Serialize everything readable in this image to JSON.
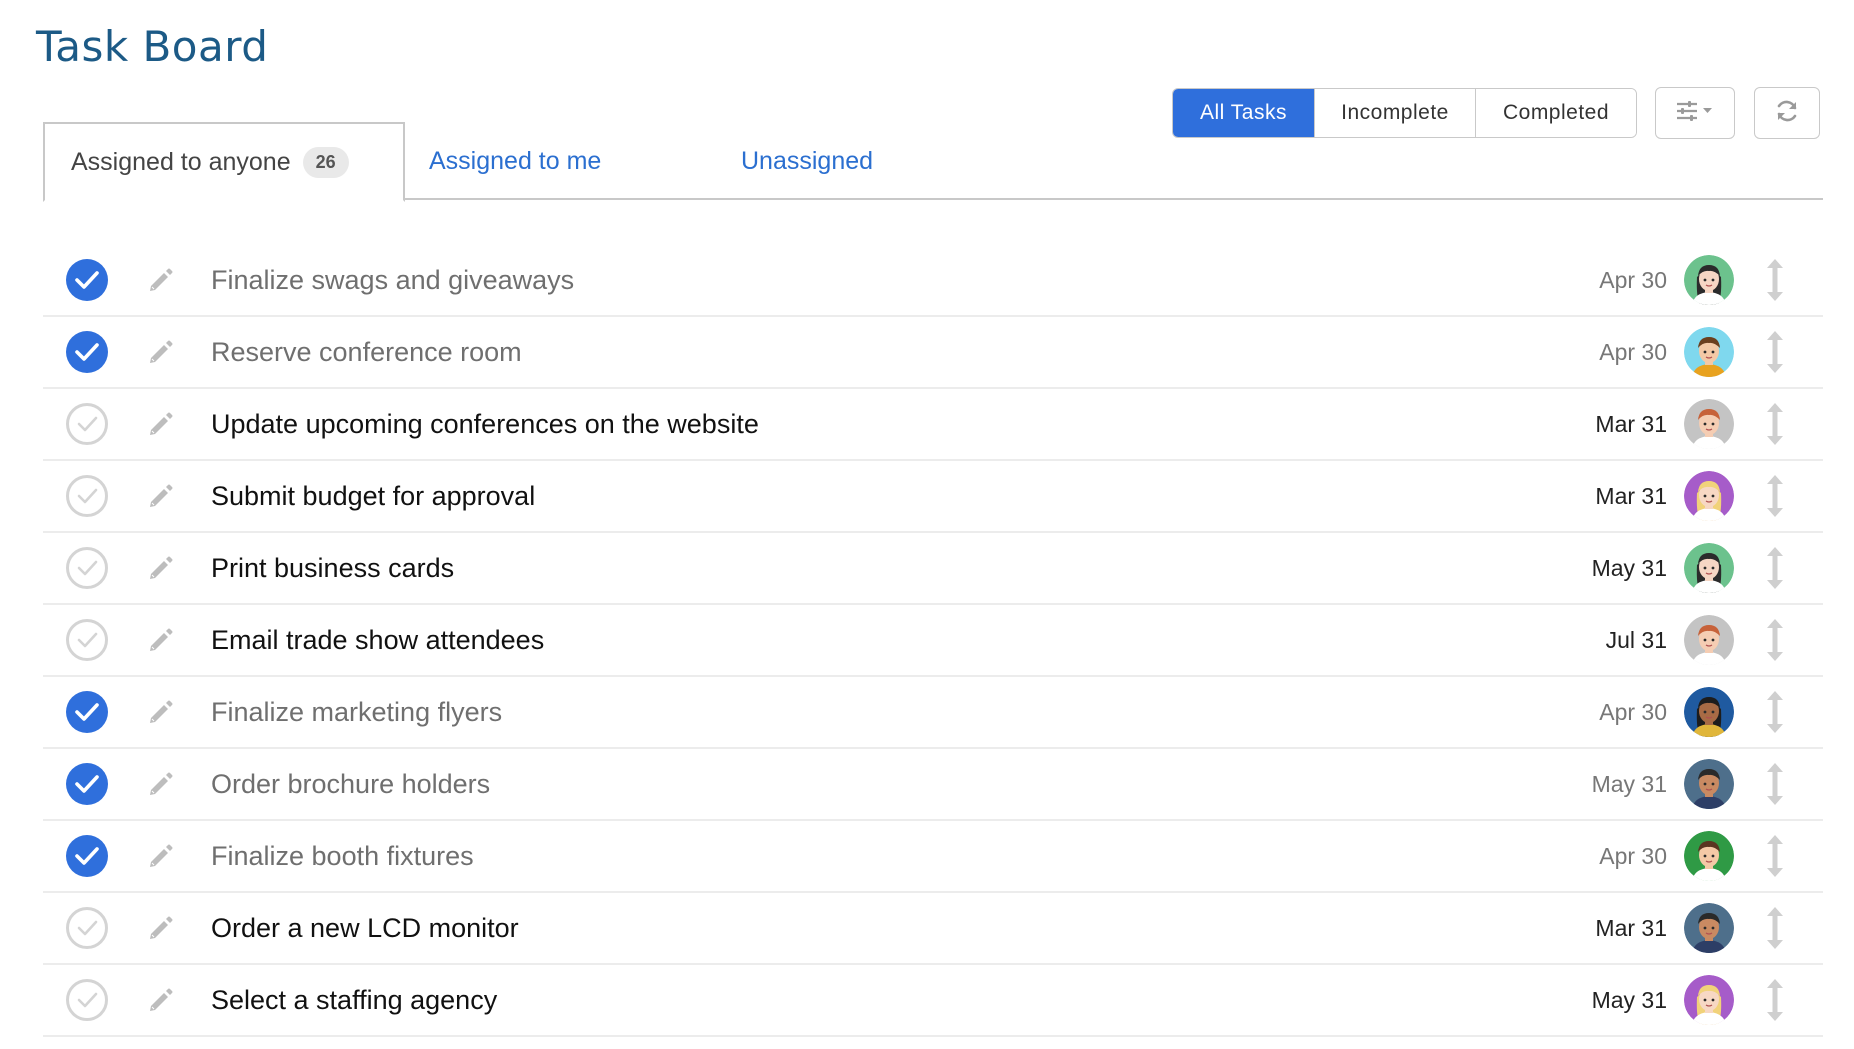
{
  "header": {
    "title": "Task Board"
  },
  "filters": {
    "all": "All Tasks",
    "incomplete": "Incomplete",
    "completed": "Completed",
    "active": "all"
  },
  "tabs": [
    {
      "label": "Assigned to anyone",
      "count": "26",
      "active": true
    },
    {
      "label": "Assigned to me"
    },
    {
      "label": "Unassigned"
    }
  ],
  "colors": {
    "accent": "#2f6fdc",
    "title": "#1c5a86",
    "link": "#2b6fd0"
  },
  "tasks": [
    {
      "title": "Finalize swags and giveaways",
      "date": "Apr 30",
      "done": true,
      "avatar": "woman-dark-hair-green"
    },
    {
      "title": "Reserve conference room",
      "date": "Apr 30",
      "done": true,
      "avatar": "man-brown-hair-cyan"
    },
    {
      "title": "Update upcoming conferences on the website",
      "date": "Mar 31",
      "done": false,
      "avatar": "man-red-hair-grey"
    },
    {
      "title": "Submit budget for approval",
      "date": "Mar 31",
      "done": false,
      "avatar": "woman-blonde-purple"
    },
    {
      "title": "Print business cards",
      "date": "May 31",
      "done": false,
      "avatar": "woman-dark-hair-green"
    },
    {
      "title": "Email trade show attendees",
      "date": "Jul 31",
      "done": false,
      "avatar": "man-red-hair-grey"
    },
    {
      "title": "Finalize marketing flyers",
      "date": "Apr 30",
      "done": true,
      "avatar": "woman-curly-navy"
    },
    {
      "title": "Order brochure holders",
      "date": "May 31",
      "done": true,
      "avatar": "man-dark-hair-slate"
    },
    {
      "title": "Finalize booth fixtures",
      "date": "Apr 30",
      "done": true,
      "avatar": "man-brown-hair-green"
    },
    {
      "title": "Order a new LCD monitor",
      "date": "Mar 31",
      "done": false,
      "avatar": "man-dark-hair-slate"
    },
    {
      "title": "Select a staffing agency",
      "date": "May 31",
      "done": false,
      "avatar": "woman-blonde-purple"
    }
  ]
}
